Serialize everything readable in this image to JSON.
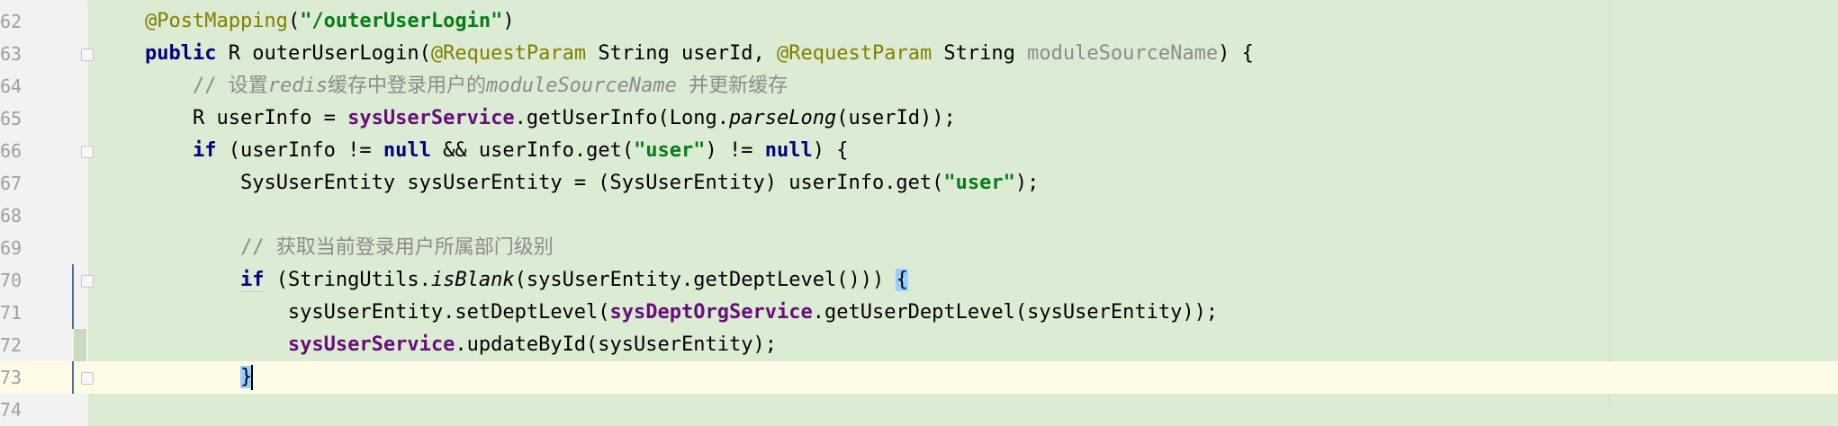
{
  "editor": {
    "lines": [
      {
        "num": "62",
        "segments": [
          [
            "indent",
            "    "
          ],
          [
            "ann",
            "@PostMapping"
          ],
          [
            "plain",
            "("
          ],
          [
            "str",
            "\"/outerUserLogin\""
          ],
          [
            "plain",
            ")"
          ]
        ]
      },
      {
        "num": "63",
        "fold": true,
        "segments": [
          [
            "indent",
            "    "
          ],
          [
            "kw",
            "public"
          ],
          [
            "plain",
            " R outerUserLogin("
          ],
          [
            "ann",
            "@RequestParam"
          ],
          [
            "plain",
            " String userId, "
          ],
          [
            "ann",
            "@RequestParam"
          ],
          [
            "plain",
            " String "
          ],
          [
            "param-unused",
            "moduleSourceName"
          ],
          [
            "plain",
            ") {"
          ]
        ]
      },
      {
        "num": "64",
        "segments": [
          [
            "indent",
            "        "
          ],
          [
            "cmt",
            "// 设置"
          ],
          [
            "cmt-it",
            "redis"
          ],
          [
            "cmt",
            "缓存中登录用户的"
          ],
          [
            "cmt-it",
            "moduleSourceName"
          ],
          [
            "cmt",
            " 并更新缓存"
          ]
        ]
      },
      {
        "num": "65",
        "segments": [
          [
            "indent",
            "        "
          ],
          [
            "plain",
            "R userInfo = "
          ],
          [
            "field",
            "sysUserService"
          ],
          [
            "plain",
            ".getUserInfo(Long."
          ],
          [
            "it",
            "parseLong"
          ],
          [
            "plain",
            "(userId));"
          ]
        ]
      },
      {
        "num": "66",
        "fold": true,
        "segments": [
          [
            "indent",
            "        "
          ],
          [
            "kw",
            "if"
          ],
          [
            "plain",
            " (userInfo != "
          ],
          [
            "kw",
            "null"
          ],
          [
            "plain",
            " && userInfo.get("
          ],
          [
            "str",
            "\"user\""
          ],
          [
            "plain",
            ") != "
          ],
          [
            "kw",
            "null"
          ],
          [
            "plain",
            ") {"
          ]
        ]
      },
      {
        "num": "67",
        "segments": [
          [
            "indent",
            "            "
          ],
          [
            "plain",
            "SysUserEntity sysUserEntity = (SysUserEntity) userInfo.get("
          ],
          [
            "str",
            "\"user\""
          ],
          [
            "plain",
            ");"
          ]
        ]
      },
      {
        "num": "68",
        "segments": []
      },
      {
        "num": "69",
        "segments": [
          [
            "indent",
            "            "
          ],
          [
            "cmt",
            "// 获取当前登录用户所属部门级别"
          ]
        ]
      },
      {
        "num": "70",
        "fold": true,
        "change": "line",
        "segments": [
          [
            "indent",
            "            "
          ],
          [
            "kw-ul",
            "if"
          ],
          [
            "plain",
            " (StringUtils."
          ],
          [
            "it",
            "isBlank"
          ],
          [
            "plain",
            "(sysUserEntity.getDeptLevel())) "
          ],
          [
            "brace",
            "{"
          ]
        ]
      },
      {
        "num": "71",
        "change": "line",
        "segments": [
          [
            "indent",
            "                "
          ],
          [
            "plain",
            "sysUserEntity.setDeptLevel("
          ],
          [
            "field",
            "sysDeptOrgService"
          ],
          [
            "plain",
            ".getUserDeptLevel(sysUserEntity));"
          ]
        ]
      },
      {
        "num": "72",
        "change": "bar",
        "segments": [
          [
            "indent",
            "                "
          ],
          [
            "field",
            "sysUserService"
          ],
          [
            "plain",
            ".updateById(sysUserEntity);"
          ]
        ]
      },
      {
        "num": "73",
        "fold": true,
        "change": "line",
        "current": true,
        "segments": [
          [
            "indent",
            "            "
          ],
          [
            "brace-caret",
            "}"
          ]
        ]
      },
      {
        "num": "74",
        "segments": []
      }
    ]
  }
}
